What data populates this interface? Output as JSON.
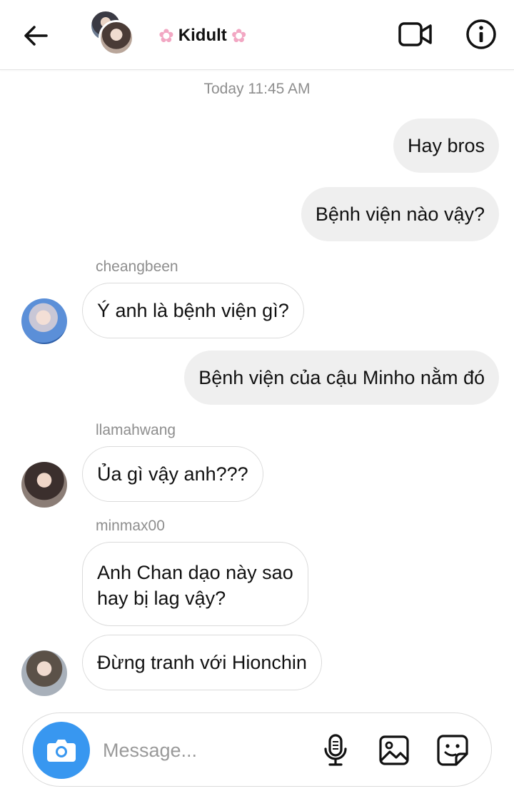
{
  "header": {
    "title": "Kidult",
    "back_icon": "back-arrow-icon",
    "video_icon": "video-camera-icon",
    "info_icon": "info-icon"
  },
  "timestamp": "Today 11:45 AM",
  "messages": [
    {
      "direction": "out",
      "text": "Hay bros"
    },
    {
      "direction": "out",
      "text": "Bệnh viện nào vậy?"
    },
    {
      "direction": "in",
      "sender": "cheangbeen",
      "text": "Ý anh là bệnh viện gì?"
    },
    {
      "direction": "out",
      "text": "Bệnh viện của cậu Minho nằm đó"
    },
    {
      "direction": "in",
      "sender": "llamahwang",
      "text": "Ủa gì vậy anh???"
    },
    {
      "direction": "in",
      "sender": "minmax00",
      "text_line1": "Anh Chan dạo này sao",
      "text_line2": "hay bị lag vậy?"
    },
    {
      "direction": "in",
      "text": "Đừng tranh với Hionchin"
    }
  ],
  "composer": {
    "placeholder": "Message...",
    "camera_icon": "camera-icon",
    "mic_icon": "microphone-icon",
    "gallery_icon": "image-gallery-icon",
    "sticker_icon": "sticker-icon"
  },
  "colors": {
    "accent": "#3897f0",
    "outgoing_bubble": "#efefef",
    "muted_text": "#8e8e8e",
    "blossom": "#f2a7c3"
  }
}
